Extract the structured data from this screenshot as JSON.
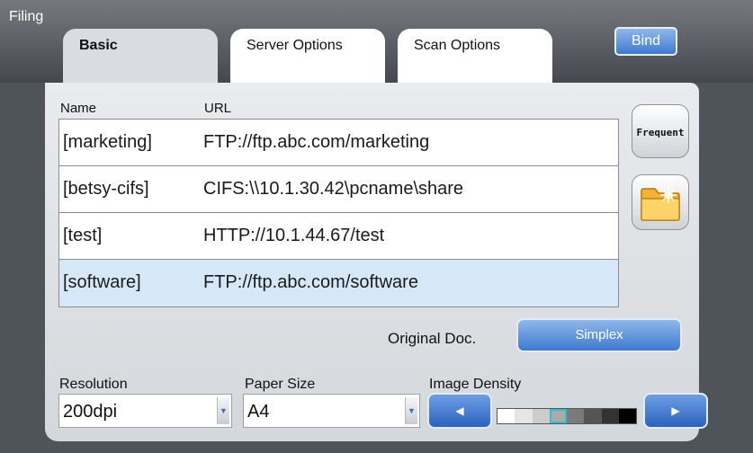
{
  "header": {
    "title": "Filing",
    "tabs": [
      {
        "label": "Basic",
        "active": true
      },
      {
        "label": "Server Options",
        "active": false
      },
      {
        "label": "Scan Options",
        "active": false
      }
    ],
    "bind_label": "Bind"
  },
  "list": {
    "columns": {
      "name": "Name",
      "url": "URL"
    },
    "items": [
      {
        "name": "[marketing]",
        "url": "FTP://ftp.abc.com/marketing",
        "selected": false
      },
      {
        "name": "[betsy-cifs]",
        "url": "CIFS:\\\\10.1.30.42\\pcname\\share",
        "selected": false
      },
      {
        "name": "[test]",
        "url": "HTTP://10.1.44.67/test",
        "selected": false
      },
      {
        "name": "[software]",
        "url": "FTP://ftp.abc.com/software",
        "selected": true
      }
    ]
  },
  "side_buttons": {
    "frequent_label": "Frequent",
    "folder_icon": "folder-icon"
  },
  "original_doc": {
    "label": "Original Doc.",
    "value": "Simplex"
  },
  "resolution": {
    "label": "Resolution",
    "value": "200dpi"
  },
  "paper_size": {
    "label": "Paper Size",
    "value": "A4"
  },
  "image_density": {
    "label": "Image Density",
    "levels": [
      "#ffffff",
      "#e6e6e6",
      "#cccccc",
      "#aaaaaa",
      "#7a7a7a",
      "#555555",
      "#333333",
      "#000000"
    ],
    "selected_index": 3
  },
  "colors": {
    "accent_blue": "#3f79cf",
    "selected_row": "#d6e8f8",
    "density_highlight": "#32c0d0"
  }
}
